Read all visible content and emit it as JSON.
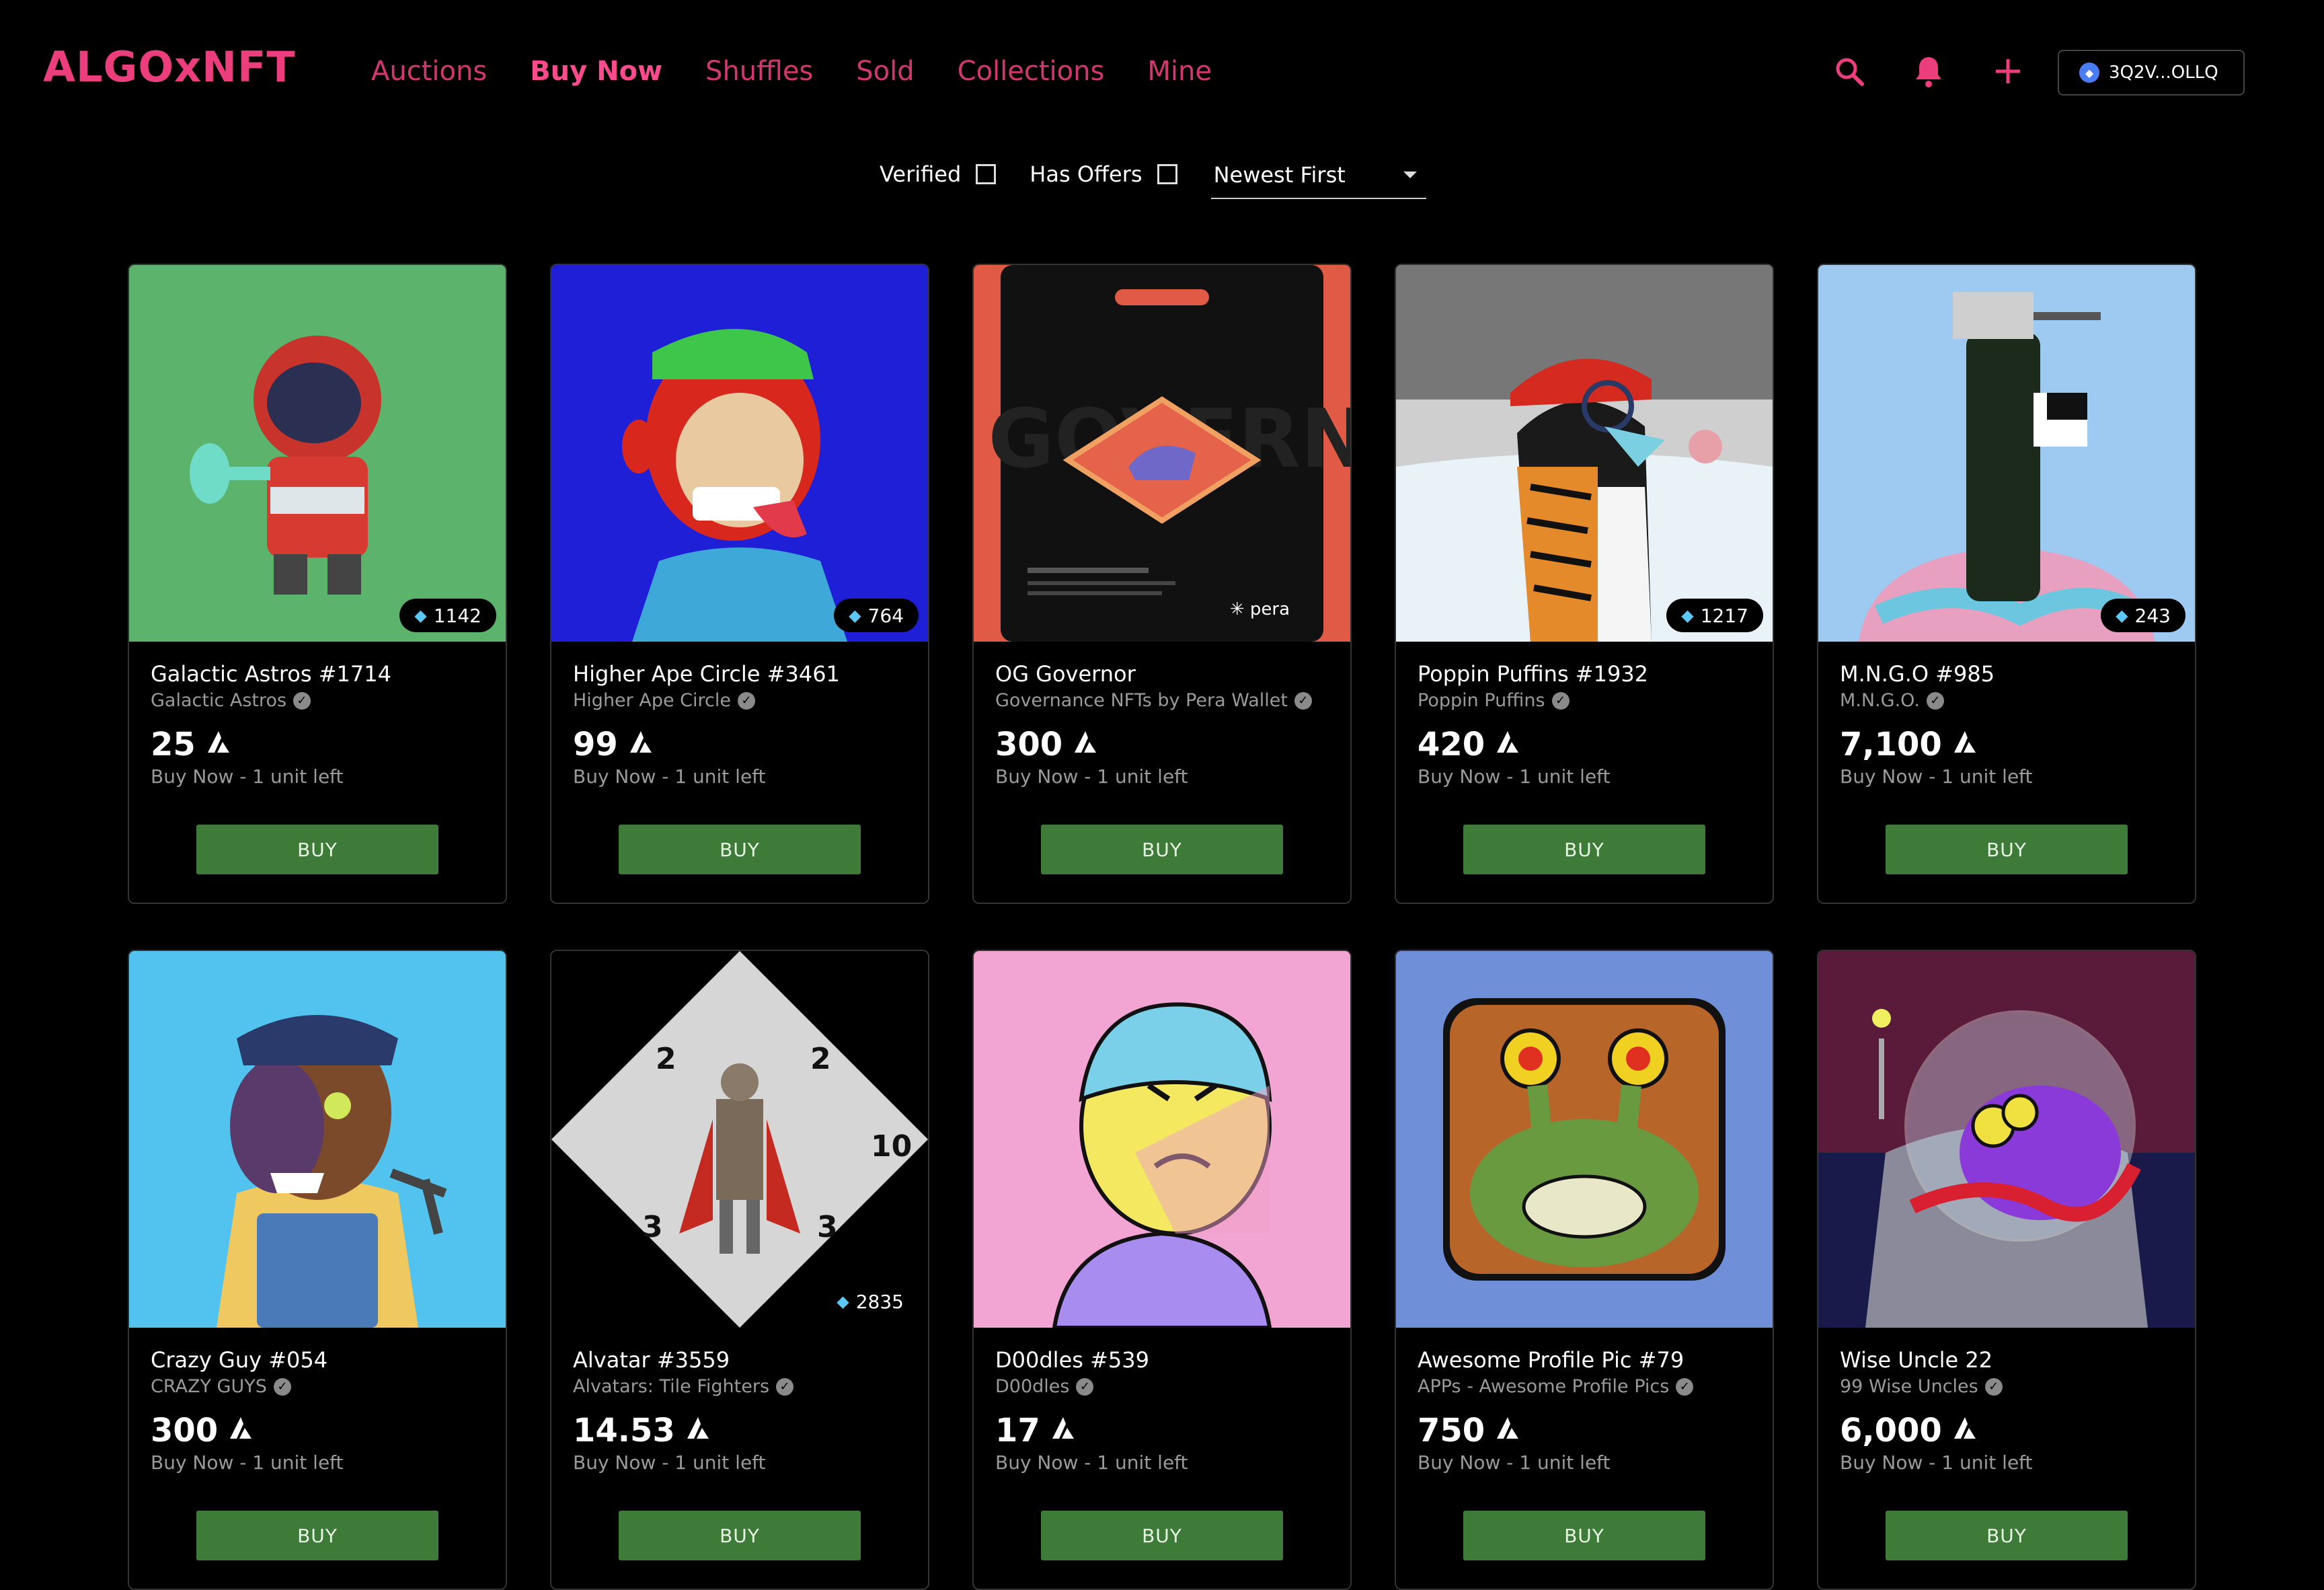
{
  "header": {
    "logo": "ALGOxNFT",
    "nav": [
      "Auctions",
      "Buy Now",
      "Shuffles",
      "Sold",
      "Collections",
      "Mine"
    ],
    "active_nav": "Buy Now",
    "wallet": "3Q2V...OLLQ"
  },
  "filters": {
    "verified_label": "Verified",
    "offers_label": "Has Offers",
    "sort_value": "Newest First"
  },
  "buy_label": "BUY",
  "cards": [
    {
      "name": "Galactic Astros #1714",
      "collection": "Galactic Astros",
      "price": "25",
      "status": "Buy Now - 1 unit left",
      "badge": "1142",
      "bg": "#5fb36a",
      "icon": "astronaut-image"
    },
    {
      "name": "Higher Ape Circle #3461",
      "collection": "Higher Ape Circle",
      "price": "99",
      "status": "Buy Now - 1 unit left",
      "badge": "764",
      "bg": "#1f1fd6",
      "icon": "ape-image"
    },
    {
      "name": "OG Governor",
      "collection": "Governance NFTs by Pera Wallet",
      "price": "300",
      "status": "Buy Now - 1 unit left",
      "badge": "",
      "bg": "#e05a45",
      "icon": "governor-pin-image"
    },
    {
      "name": "Poppin Puffins #1932",
      "collection": "Poppin Puffins",
      "price": "420",
      "status": "Buy Now - 1 unit left",
      "badge": "1217",
      "bg": "#d8d8d8",
      "icon": "puffin-image"
    },
    {
      "name": "M.N.G.O #985",
      "collection": "M.N.G.O.",
      "price": "7,100",
      "status": "Buy Now - 1 unit left",
      "badge": "243",
      "bg": "#9ec9f0",
      "icon": "mngo-image"
    },
    {
      "name": "Crazy Guy #054",
      "collection": "CRAZY GUYS",
      "price": "300",
      "status": "Buy Now - 1 unit left",
      "badge": "",
      "bg": "#52c3ee",
      "icon": "crazy-guy-image"
    },
    {
      "name": "Alvatar #3559",
      "collection": "Alvatars: Tile Fighters",
      "price": "14.53",
      "status": "Buy Now - 1 unit left",
      "badge": "2835",
      "bg": "#000000",
      "icon": "alvatar-tile-image"
    },
    {
      "name": "D00dles #539",
      "collection": "D00dles",
      "price": "17",
      "status": "Buy Now - 1 unit left",
      "badge": "",
      "bg": "#f2a5d2",
      "icon": "doodle-image"
    },
    {
      "name": "Awesome Profile Pic #79",
      "collection": "APPs - Awesome Profile Pics",
      "price": "750",
      "status": "Buy Now - 1 unit left",
      "badge": "",
      "bg": "#6f8fd8",
      "icon": "snail-image"
    },
    {
      "name": "Wise Uncle 22",
      "collection": "99 Wise Uncles",
      "price": "6,000",
      "status": "Buy Now - 1 unit left",
      "badge": "",
      "bg": "#5a1a3a",
      "icon": "wise-uncle-image"
    }
  ],
  "pera_label": "pera",
  "pin_text": "OG GOVERNOR",
  "tile_numbers": [
    "2",
    "2",
    "10",
    "3",
    "3"
  ]
}
